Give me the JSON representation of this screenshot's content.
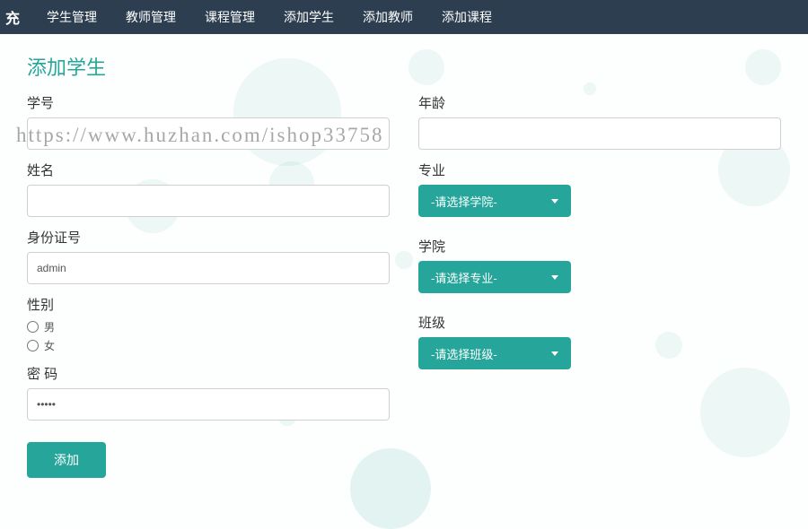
{
  "nav": {
    "brand_cut": "充",
    "items": [
      "学生管理",
      "教师管理",
      "课程管理",
      "添加学生",
      "添加教师",
      "添加课程"
    ]
  },
  "page": {
    "title": "添加学生"
  },
  "form": {
    "student_id": {
      "label": "学号",
      "value": ""
    },
    "name": {
      "label": "姓名",
      "value": ""
    },
    "id_card": {
      "label": "身份证号",
      "value": "admin"
    },
    "gender": {
      "label": "性别",
      "options": [
        {
          "label": "男",
          "value": "male"
        },
        {
          "label": "女",
          "value": "female"
        }
      ]
    },
    "password": {
      "label": "密 码",
      "value": "....."
    },
    "age": {
      "label": "年龄",
      "value": ""
    },
    "major": {
      "label": "专业",
      "selected": "-请选择学院-"
    },
    "college": {
      "label": "学院",
      "selected": "-请选择专业-"
    },
    "class": {
      "label": "班级",
      "selected": "-请选择班级-"
    },
    "submit": "添加"
  },
  "watermark": "https://www.huzhan.com/ishop33758"
}
